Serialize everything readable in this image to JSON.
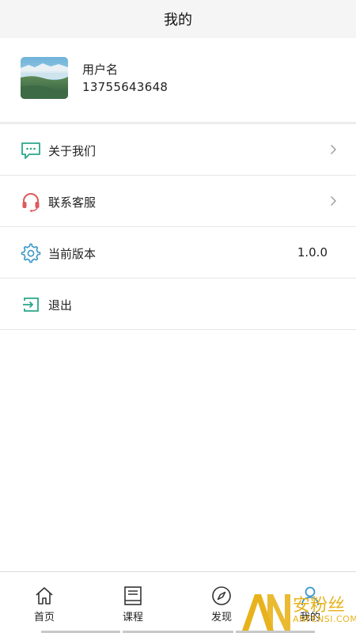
{
  "header": {
    "title": "我的"
  },
  "profile": {
    "username": "用户名",
    "phone": "13755643648",
    "avatar_icon": "mountain-landscape-avatar"
  },
  "menu": [
    {
      "label": "关于我们",
      "icon": "chat-bubble-icon",
      "color": "#2aa889",
      "has_arrow": true
    },
    {
      "label": "联系客服",
      "icon": "headset-icon",
      "color": "#e05a5a",
      "has_arrow": true
    },
    {
      "label": "当前版本",
      "icon": "gear-icon",
      "color": "#3a97c9",
      "value": "1.0.0"
    },
    {
      "label": "退出",
      "icon": "exit-icon",
      "color": "#2aa889"
    }
  ],
  "tabbar": [
    {
      "label": "首页",
      "icon": "home-icon"
    },
    {
      "label": "课程",
      "icon": "book-icon"
    },
    {
      "label": "发现",
      "icon": "compass-icon"
    },
    {
      "label": "我的",
      "icon": "person-icon",
      "active": true
    }
  ],
  "watermark": {
    "cn": "安粉丝",
    "en": "ANFENSI.COM",
    "color": "#e8b21c"
  }
}
